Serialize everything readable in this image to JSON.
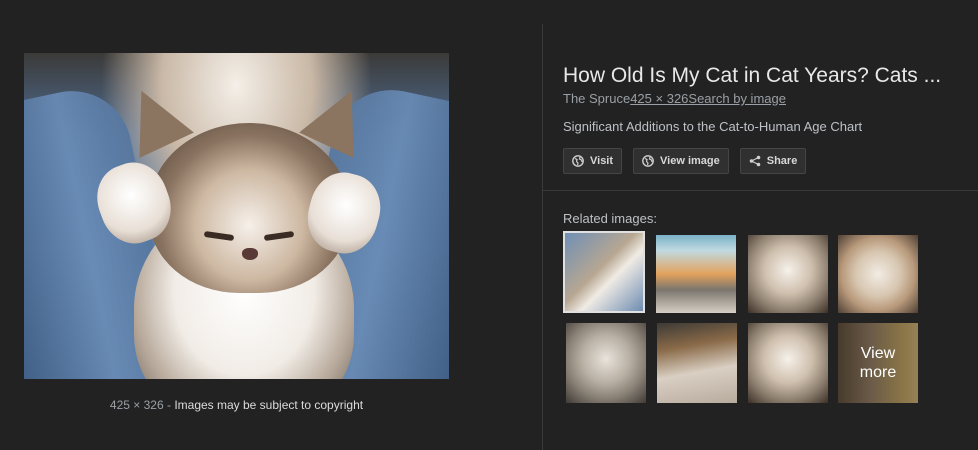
{
  "preview": {
    "dimensions": "425 × 326",
    "separator": "-",
    "copyright": "Images may be subject to copyright"
  },
  "info": {
    "title": "How Old Is My Cat in Cat Years? Cats ...",
    "source": "The Spruce",
    "size_link": "425 × 326",
    "search_link": "Search by image",
    "description": "Significant Additions to the Cat-to-Human Age Chart"
  },
  "buttons": {
    "visit": "Visit",
    "view_image": "View image",
    "share": "Share"
  },
  "related": {
    "label": "Related images:",
    "view_more_line1": "View",
    "view_more_line2": "more"
  },
  "colors": {
    "background": "#222222",
    "button_bg": "#303030",
    "muted_text": "#9aa0a6"
  },
  "icons": {
    "visit": "globe-icon",
    "view_image": "globe-icon",
    "share": "share-icon"
  }
}
